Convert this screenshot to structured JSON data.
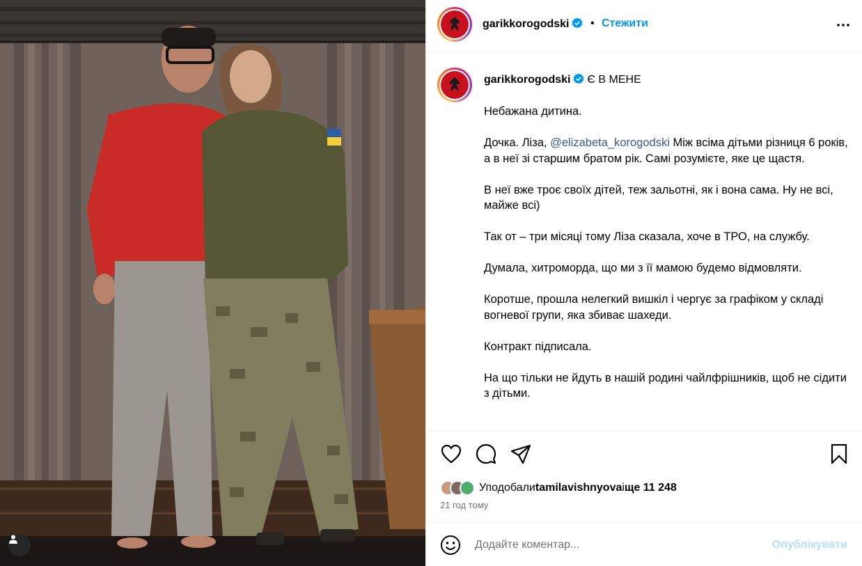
{
  "post": {
    "username": "garikkorogodski",
    "follow_label": "Стежити",
    "separator": "•",
    "more_icon": "more-horizontal-icon"
  },
  "caption": {
    "username": "garikkorogodski",
    "title": "Є В МЕНЕ",
    "paragraphs": {
      "p1": "Небажана дитина.",
      "p2_before": "Дочка. Ліза, ",
      "p2_mention": "@elizabeta_korogodski",
      "p2_after": " Між всіма дітьми різниця 6 років, а в неї зі старшим братом рік. Самі розумієте, яке це щастя.",
      "p3": "В неї вже троє своїх дітей, теж зальотні, як і вона сама. Ну не всі, майже всі)",
      "p4": "Так от – три місяці тому Ліза сказала, хоче в ТРО, на службу.",
      "p5": "Думала, хитроморда, що ми з її мамою будемо відмовляти.",
      "p6": "Коротше, прошла нелегкий вишкіл і чергує за графіком у складі вогневої групи, яка збиває шахеди.",
      "p7": "Контракт підписала.",
      "p8": "На що тільки не йдуть в нашій родині чайлфрішників, щоб не сідити з дітьми."
    }
  },
  "likes": {
    "prefix": "Уподобали ",
    "user": "tamilavishnyova",
    "middle": " і ",
    "count": "ще 11 248"
  },
  "timestamp": "21 год тому",
  "comment": {
    "placeholder": "Додайте коментар...",
    "value": "",
    "post_label": "Опублікувати"
  },
  "colors": {
    "accent": "#0095f6",
    "mention": "#385898",
    "post_disabled": "#b2dffc",
    "muted": "#737373",
    "divider": "#efefef",
    "logo_red": "#c8101e"
  }
}
